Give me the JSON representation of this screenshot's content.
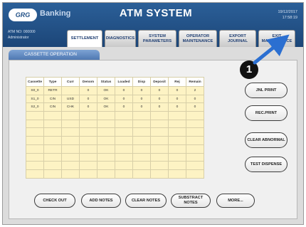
{
  "header": {
    "logo_text": "GRG",
    "brand": "Banking",
    "title": "ATM SYSTEM",
    "date": "19/12/2017",
    "time": "17:58:19",
    "atm_no": "ATM NO: 000000",
    "role": "Administrator"
  },
  "tabs": [
    {
      "label": "SETTLEMENT"
    },
    {
      "label": "DIAGNOSTICS"
    },
    {
      "label": "SYSTEM PARAMETERS"
    },
    {
      "label": "OPERATOR MAINTENANCE"
    },
    {
      "label": "EXPORT JOURNAL"
    },
    {
      "label": "EXIT MAINTENANCE"
    }
  ],
  "subtab": "CASSETTE OPERATION",
  "table": {
    "headers": [
      "Cassette",
      "Type",
      "Curr",
      "Denom",
      "Status",
      "Loaded",
      "Disp",
      "Deposit",
      "Rej",
      "Remain"
    ],
    "rows": [
      [
        "S0_0",
        "RETR",
        "",
        "0",
        "OK",
        "0",
        "0",
        "0",
        "0",
        "2"
      ],
      [
        "S1_0",
        "CIN",
        "USD",
        "0",
        "OK",
        "0",
        "0",
        "0",
        "0",
        "0"
      ],
      [
        "S2_0",
        "CIN",
        "CHK",
        "0",
        "OK",
        "0",
        "0",
        "0",
        "0",
        "0"
      ]
    ],
    "empty_rows": 8
  },
  "right_buttons": [
    "JNL PRINT",
    "REC.PRINT",
    "CLEAR ABNORMAL",
    "TEST DISPENSE"
  ],
  "bottom_buttons": [
    "CHECK OUT",
    "ADD NOTES",
    "CLEAR NOTES",
    "SUBSTRACT NOTES",
    "MORE..."
  ],
  "annotation": {
    "number": "1"
  },
  "colors": {
    "header_blue": "#1c4678",
    "row_yellow": "#fdf3c4",
    "arrow": "#2b6fd1"
  }
}
